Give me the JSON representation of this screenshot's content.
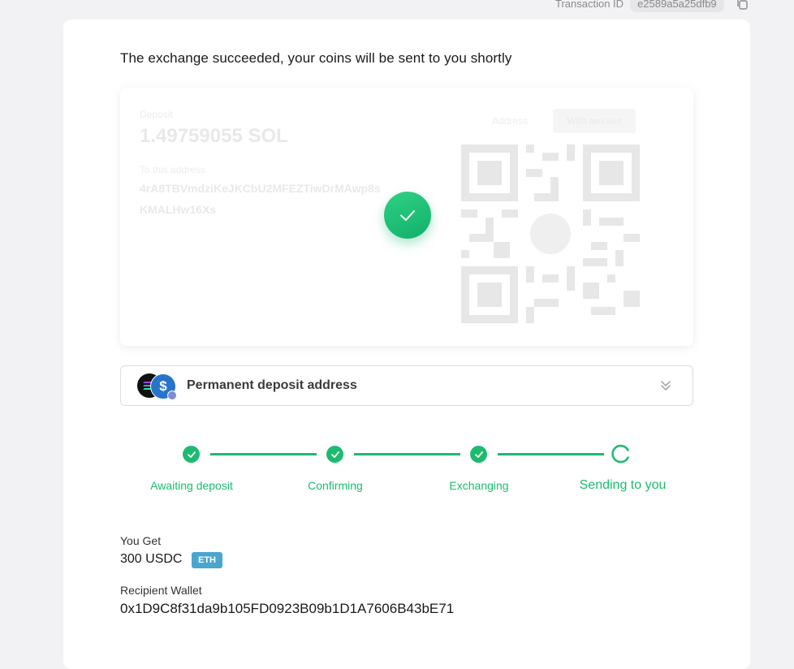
{
  "transaction": {
    "label": "Transaction ID",
    "id": "e2589a5a25dfb9"
  },
  "headline": "The exchange succeeded, your coins will be sent to you shortly",
  "deposit": {
    "send_label": "Deposit",
    "amount": "1.49759055 SOL",
    "address_label": "To this address",
    "address_line1": "4rA8TBVmdziKeJKCbU2MFEZTiwDrMAwp8s",
    "address_line2": "KMALHw16Xs",
    "tab_address": "Address",
    "tab_qr": "With amount"
  },
  "permanent_deposit": {
    "label": "Permanent deposit address"
  },
  "steps": [
    {
      "label": "Awaiting deposit",
      "status": "done"
    },
    {
      "label": "Confirming",
      "status": "done"
    },
    {
      "label": "Exchanging",
      "status": "done"
    },
    {
      "label": "Sending to you",
      "status": "active"
    }
  ],
  "summary": {
    "you_get_label": "You Get",
    "you_get_value": "300 USDC",
    "network_badge": "ETH",
    "recipient_label": "Recipient Wallet",
    "recipient_value": "0x1D9C8f31da9b105FD0923B09b1D1A7606B43bE71"
  },
  "colors": {
    "accent": "#1dbb6f",
    "badge": "#4aa5cf",
    "usdc": "#2775ca"
  },
  "icons": [
    "copy-icon",
    "check-icon",
    "chevron-double-down-icon",
    "spinner-icon",
    "solana-coin-icon",
    "usdc-coin-icon",
    "ethereum-coin-icon"
  ]
}
